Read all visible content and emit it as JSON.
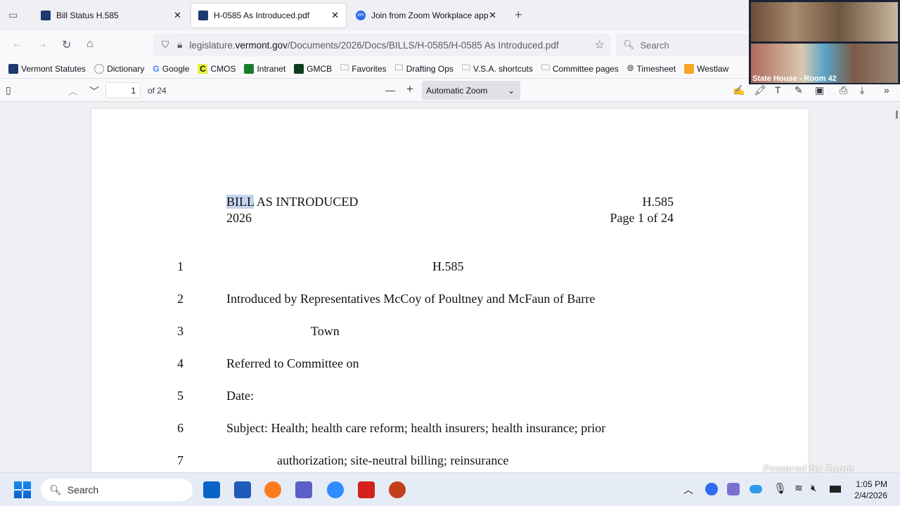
{
  "tabs": [
    {
      "label": "Bill Status H.585"
    },
    {
      "label": "H-0585 As Introduced.pdf",
      "active": true
    },
    {
      "label": "Join from Zoom Workplace app"
    }
  ],
  "url": {
    "host_pre": "legislature.",
    "host": "vermont.gov",
    "path": "/Documents/2026/Docs/BILLS/H-0585/H-0585 As Introduced.pdf"
  },
  "search_placeholder": "Search",
  "bookmarks": [
    "Vermont Statutes",
    "Dictionary",
    "Google",
    "CMOS",
    "Intranet",
    "GMCB",
    "Favorites",
    "Drafting Ops",
    "V.S.A. shortcuts",
    "Committee pages",
    "Timesheet",
    "Westlaw"
  ],
  "pdf_toolbar": {
    "page": "1",
    "of": "of 24",
    "zoom": "Automatic Zoom"
  },
  "video": {
    "label": "State House - Room 42",
    "watermark": "Powered by Zoom"
  },
  "document": {
    "header_left_1_hl": "BILL",
    "header_left_1_rest": " AS INTRODUCED",
    "header_left_2": "2026",
    "header_right_1": "H.585",
    "header_right_2": "Page 1 of 24",
    "lines": [
      {
        "n": "1",
        "text": "H.585"
      },
      {
        "n": "2",
        "text": "Introduced by  Representatives McCoy of Poultney and McFaun of Barre"
      },
      {
        "n": "3",
        "text": "Town"
      },
      {
        "n": "4",
        "text": "Referred to Committee on"
      },
      {
        "n": "5",
        "text": "Date:"
      },
      {
        "n": "6",
        "text": "Subject: Health; health care reform; health insurers; health insurance; prior"
      },
      {
        "n": "7",
        "text": "authorization; site-neutral billing; reinsurance"
      }
    ]
  },
  "taskbar": {
    "search": "Search",
    "time": "1:05 PM",
    "date": "2/4/2026"
  }
}
